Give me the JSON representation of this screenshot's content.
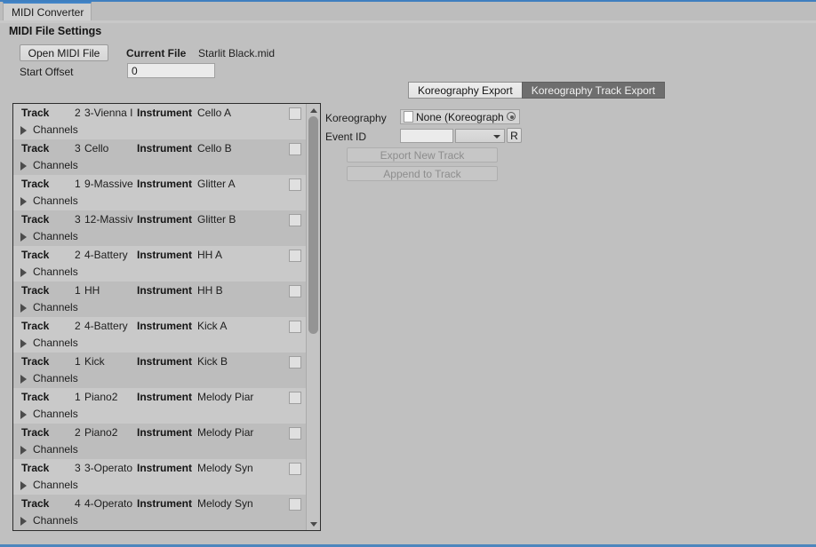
{
  "window": {
    "tab_label": "MIDI Converter",
    "accent_color": "#4285c8",
    "background_color": "#c0c0c0"
  },
  "file_settings": {
    "section_title": "MIDI File Settings",
    "open_button_label": "Open MIDI File",
    "current_file_label": "Current File",
    "current_file_value": "Starlit Black.mid",
    "start_offset_label": "Start Offset",
    "start_offset_value": "0"
  },
  "export_panel": {
    "tabs": [
      {
        "label": "Koreography Export",
        "selected": false
      },
      {
        "label": "Koreography Track Export",
        "selected": true
      }
    ],
    "koreography_label": "Koreography",
    "koreography_value": "None (Koreograph",
    "event_id_label": "Event ID",
    "event_id_value": "",
    "event_id_dropdown_value": "",
    "revert_button_label": "R",
    "export_new_track_label": "Export New Track",
    "append_to_track_label": "Append to Track"
  },
  "track_list": {
    "track_label": "Track",
    "instrument_label": "Instrument",
    "channels_label": "Channels",
    "rows": [
      {
        "number": "2",
        "name": "3-Vienna I",
        "instrument": "Cello A",
        "checked": false
      },
      {
        "number": "3",
        "name": "Cello",
        "instrument": "Cello B",
        "checked": false
      },
      {
        "number": "1",
        "name": "9-Massive",
        "instrument": "Glitter A",
        "checked": false
      },
      {
        "number": "3",
        "name": "12-Massiv",
        "instrument": "Glitter B",
        "checked": false
      },
      {
        "number": "2",
        "name": "4-Battery",
        "instrument": "HH A",
        "checked": false
      },
      {
        "number": "1",
        "name": "HH",
        "instrument": "HH B",
        "checked": false
      },
      {
        "number": "2",
        "name": "4-Battery",
        "instrument": "Kick A",
        "checked": false
      },
      {
        "number": "1",
        "name": "Kick",
        "instrument": "Kick B",
        "checked": false
      },
      {
        "number": "1",
        "name": "Piano2",
        "instrument": "Melody Piar",
        "checked": false
      },
      {
        "number": "2",
        "name": "Piano2",
        "instrument": "Melody Piar",
        "checked": false
      },
      {
        "number": "3",
        "name": "3-Operato",
        "instrument": "Melody Syn",
        "checked": false
      },
      {
        "number": "4",
        "name": "4-Operato",
        "instrument": "Melody Syn",
        "checked": false
      }
    ],
    "scrollbar": {
      "up_arrow_icon": "triangle-up-icon",
      "down_arrow_icon": "triangle-down-icon",
      "thumb_top_pct": 3,
      "thumb_height_pct": 51
    }
  }
}
